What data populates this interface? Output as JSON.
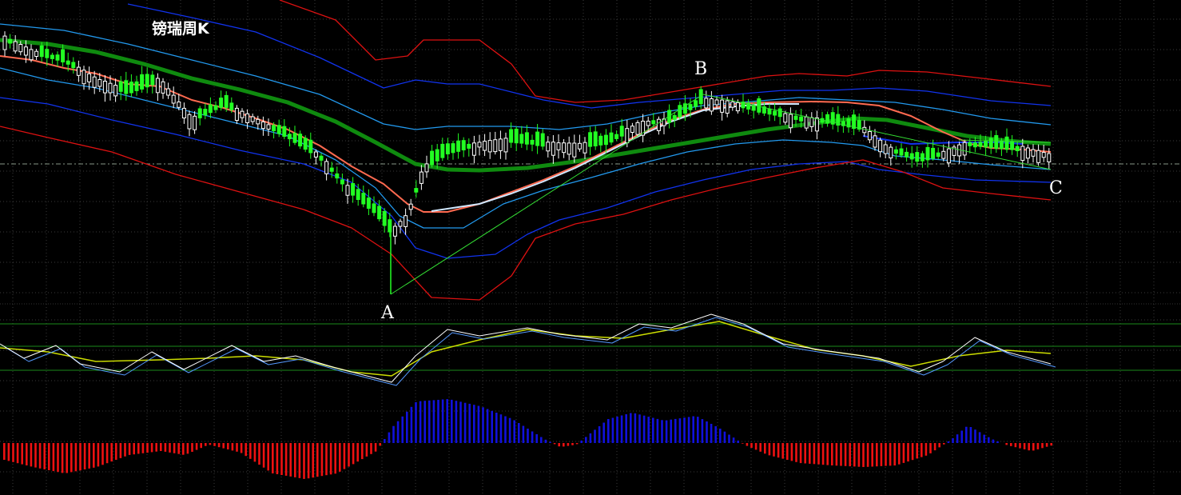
{
  "chart_data": {
    "type": "candlestick",
    "title": "镑瑞周K",
    "panels": [
      "price",
      "oscillator",
      "histogram"
    ],
    "wave_labels": [
      "A",
      "B",
      "C"
    ],
    "colors": {
      "background": "#000000",
      "grid": "#3a3a3a",
      "candle_up": "#ffffff",
      "candle_down": "#22ff22",
      "ma_red": "#ff6a50",
      "ma_green": "#0f8a0f",
      "ma_white": "#d0e8ff",
      "band_outer": "#dd1111",
      "band_mid": "#1133ee",
      "band_inner": "#2299ee",
      "trendline": "#33dd33",
      "histogram_pos": "#1111dd",
      "histogram_neg": "#ee1111",
      "osc_line_a": "#ffffff",
      "osc_line_b": "#5599ff",
      "osc_signal": "#ccdd00"
    },
    "legend": "none",
    "grid": true
  }
}
